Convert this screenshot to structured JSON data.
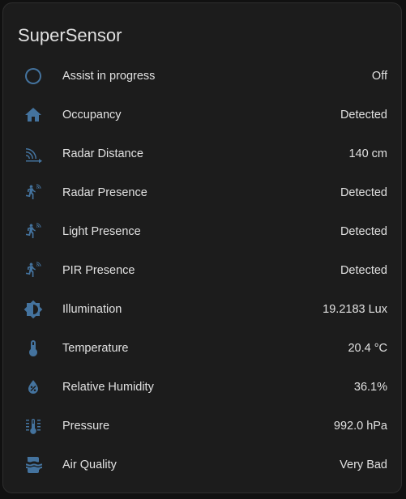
{
  "card": {
    "title": "SuperSensor",
    "rows": [
      {
        "icon": "circle-outline-icon",
        "label": "Assist in progress",
        "value": "Off"
      },
      {
        "icon": "home-icon",
        "label": "Occupancy",
        "value": "Detected"
      },
      {
        "icon": "radar-distance-icon",
        "label": "Radar Distance",
        "value": "140 cm"
      },
      {
        "icon": "motion-sensor-icon",
        "label": "Radar Presence",
        "value": "Detected"
      },
      {
        "icon": "motion-sensor-icon",
        "label": "Light Presence",
        "value": "Detected"
      },
      {
        "icon": "motion-sensor-icon",
        "label": "PIR Presence",
        "value": "Detected"
      },
      {
        "icon": "brightness-icon",
        "label": "Illumination",
        "value": "19.2183 Lux"
      },
      {
        "icon": "thermometer-icon",
        "label": "Temperature",
        "value": "20.4 °C"
      },
      {
        "icon": "water-percent-icon",
        "label": "Relative Humidity",
        "value": "36.1%"
      },
      {
        "icon": "gauge-thermometer-icon",
        "label": "Pressure",
        "value": "992.0 hPa"
      },
      {
        "icon": "air-filter-icon",
        "label": "Air Quality",
        "value": "Very Bad"
      }
    ]
  },
  "colors": {
    "background": "#111111",
    "card": "#1c1c1c",
    "icon": "#44739e",
    "text": "#e1e1e1"
  }
}
